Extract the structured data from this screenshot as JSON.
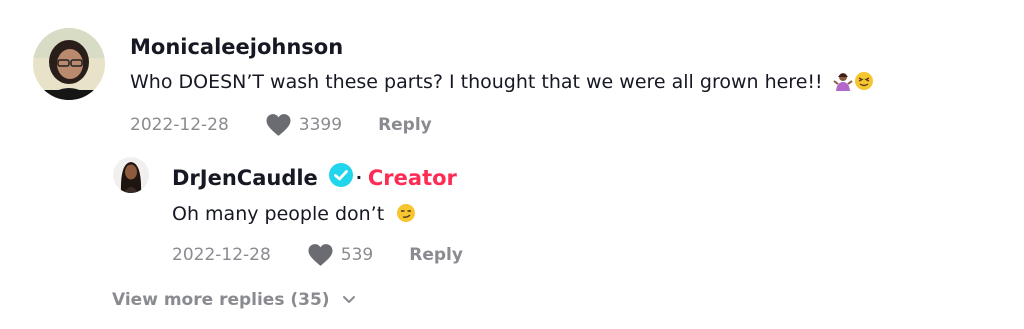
{
  "comment": {
    "username": "Monicaleejohnson",
    "text": "Who DOESN’T wash these parts? I thought that we were all grown here!!",
    "emojis": [
      "woman-shrugging-emoji",
      "squinting-face-emoji"
    ],
    "date": "2022-12-28",
    "likes": "3399",
    "reply_label": "Reply"
  },
  "reply": {
    "username": "DrJenCaudle",
    "badge_label": "Creator",
    "text": "Oh many people don’t",
    "emoji": "smirking-face-emoji",
    "date": "2022-12-28",
    "likes": "539",
    "reply_label": "Reply"
  },
  "view_more": {
    "label": "View more replies (35)"
  },
  "colors": {
    "text": "#161823",
    "muted": "#8a8b91",
    "creator": "#fe2c55",
    "verified": "#20d5ec"
  }
}
